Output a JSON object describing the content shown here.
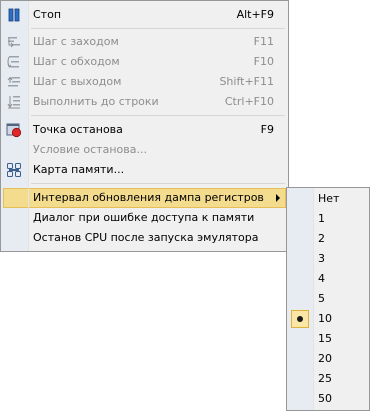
{
  "main_menu": {
    "items": [
      {
        "label": "Стоп",
        "shortcut": "Alt+F9",
        "icon": "pause-icon",
        "enabled": true
      },
      {
        "label": "Шаг с заходом",
        "shortcut": "F11",
        "icon": "step-into-icon",
        "enabled": false
      },
      {
        "label": "Шаг с обходом",
        "shortcut": "F10",
        "icon": "step-over-icon",
        "enabled": false
      },
      {
        "label": "Шаг с выходом",
        "shortcut": "Shift+F11",
        "icon": "step-out-icon",
        "enabled": false
      },
      {
        "label": "Выполнить до строки",
        "shortcut": "Ctrl+F10",
        "icon": "run-to-line-icon",
        "enabled": false
      },
      {
        "label": "Точка останова",
        "shortcut": "F9",
        "icon": "breakpoint-icon",
        "enabled": true
      },
      {
        "label": "Условие останова...",
        "shortcut": "",
        "icon": "",
        "enabled": false
      },
      {
        "label": "Карта памяти...",
        "shortcut": "",
        "icon": "memory-map-icon",
        "enabled": true
      },
      {
        "label": "Интервал обновления дампа регистров",
        "shortcut": "",
        "icon": "",
        "enabled": true,
        "highlighted": true,
        "has_submenu": true
      },
      {
        "label": "Диалог при ошибке доступа к памяти",
        "shortcut": "",
        "icon": "",
        "enabled": true
      },
      {
        "label": "Останов CPU после запуска эмулятора",
        "shortcut": "",
        "icon": "",
        "enabled": true
      }
    ]
  },
  "submenu": {
    "items": [
      "Нет",
      "1",
      "2",
      "3",
      "4",
      "5",
      "10",
      "15",
      "20",
      "25",
      "50"
    ],
    "selected": "10"
  },
  "colors": {
    "menu_bg": "#f0f0f0",
    "icon_column": "#e7ecf3",
    "highlight": "#f4dc8e",
    "highlight_border": "#e6be57",
    "disabled_text": "#8d8d8d"
  }
}
